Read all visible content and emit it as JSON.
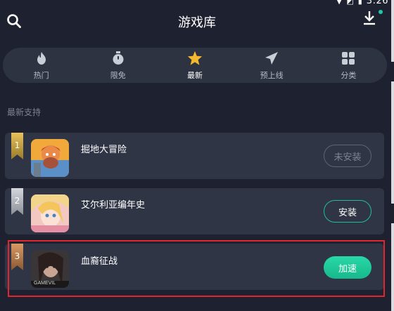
{
  "status": {
    "time": "3:26"
  },
  "header": {
    "title": "游戏库",
    "search_icon": "search-icon",
    "download_icon": "download-icon"
  },
  "tabs": [
    {
      "label": "热门",
      "icon": "flame-icon"
    },
    {
      "label": "限免",
      "icon": "stopwatch-icon"
    },
    {
      "label": "最新",
      "icon": "star-icon",
      "active": true
    },
    {
      "label": "预上线",
      "icon": "paper-plane-icon"
    },
    {
      "label": "分类",
      "icon": "grid-icon"
    }
  ],
  "section_title": "最新支持",
  "games": [
    {
      "rank": "1",
      "name": "掘地大冒险",
      "button": "未安装"
    },
    {
      "rank": "2",
      "name": "艾尔利亚编年史",
      "button": "安装"
    },
    {
      "rank": "3",
      "name": "血裔征战",
      "button": "加速",
      "icon_text": "GAMEVIL"
    }
  ],
  "colors": {
    "accent": "#1fbf99",
    "active_tab": "#f5b82e",
    "highlight": "#e0262f"
  }
}
